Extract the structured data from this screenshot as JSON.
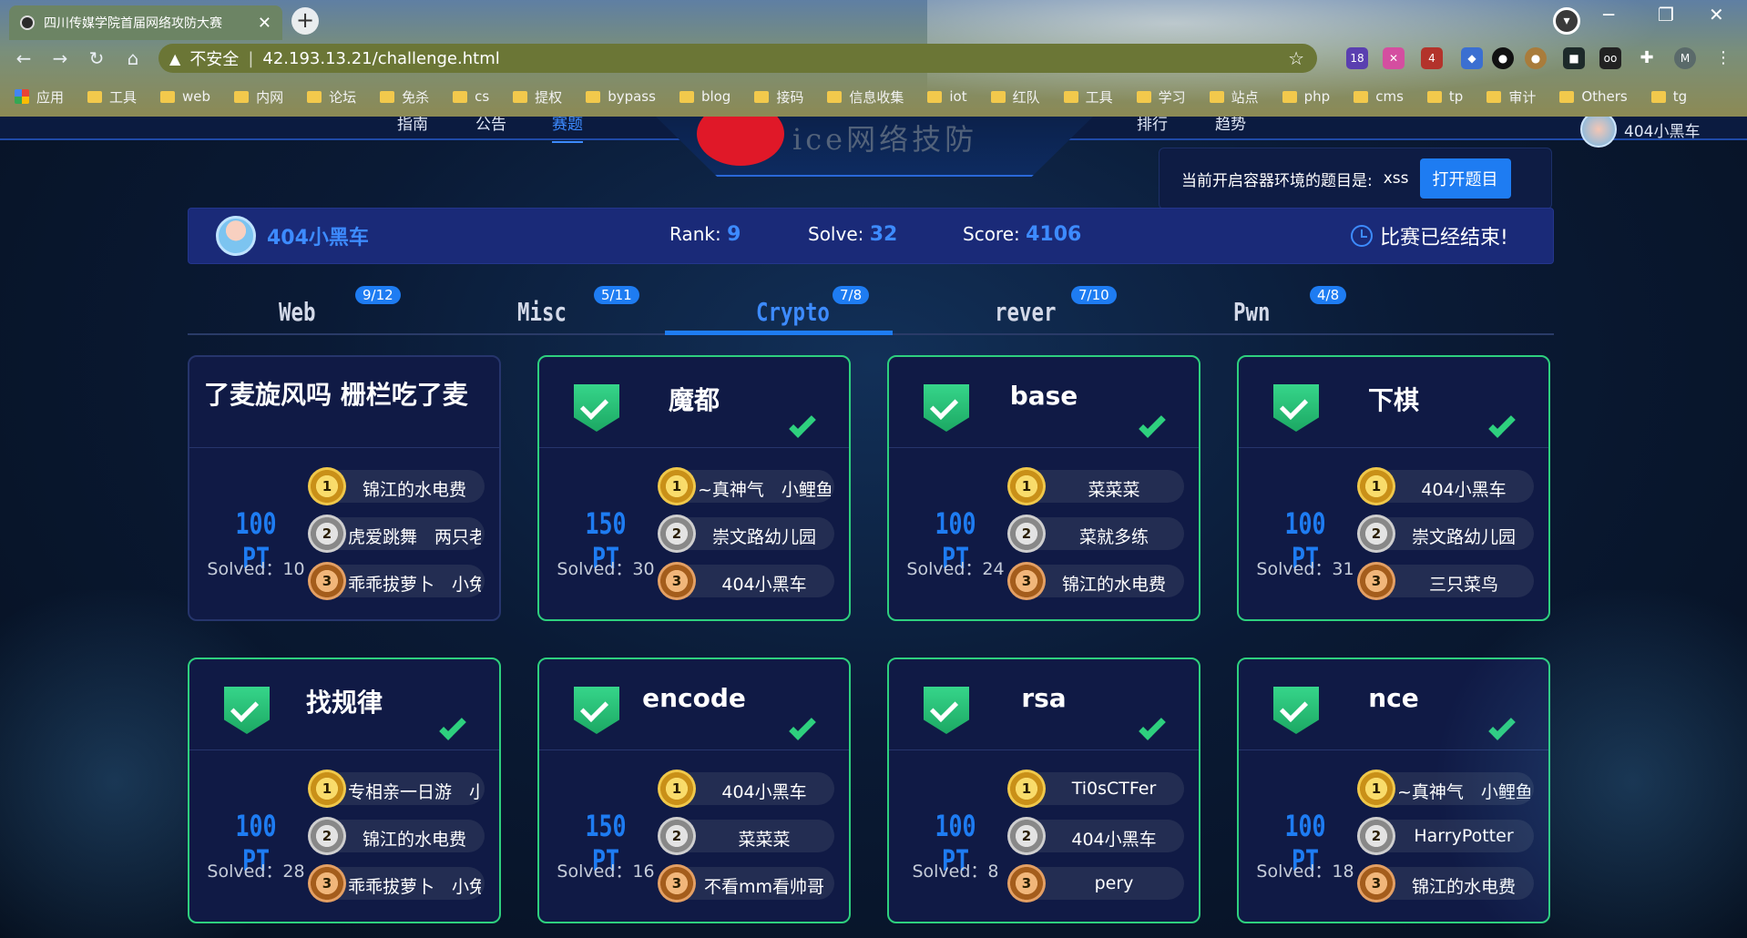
{
  "browser": {
    "tab_title": "四川传媒学院首届网络攻防大赛",
    "url_warning": "不安全",
    "url": "42.193.13.21/challenge.html",
    "profile_initial": "M",
    "ext_badge_1": "18",
    "ext_badge_2": "4",
    "bookmarks": [
      "应用",
      "工具",
      "web",
      "内网",
      "论坛",
      "免杀",
      "cs",
      "提权",
      "bypass",
      "blog",
      "接码",
      "信息收集",
      "iot",
      "红队",
      "工具",
      "学习",
      "站点",
      "php",
      "cms",
      "tp",
      "审计",
      "Others",
      "tg"
    ]
  },
  "site": {
    "nav_left": [
      "指南",
      "公告",
      "赛题"
    ],
    "nav_right": [
      "排行",
      "趋势"
    ],
    "logo_text": "ice网络技防",
    "user_top": "404小黑车",
    "container_label": "当前开启容器环境的题目是:",
    "container_value": "xss",
    "open_button": "打开题目"
  },
  "status": {
    "username": "404小黑车",
    "rank_label": "Rank:",
    "rank": "9",
    "solve_label": "Solve:",
    "solve": "32",
    "score_label": "Score:",
    "score": "4106",
    "ended_text": "比赛已经结束!"
  },
  "categories": [
    {
      "name": "Web",
      "count": "9/12"
    },
    {
      "name": "Misc",
      "count": "5/11"
    },
    {
      "name": "Crypto",
      "count": "7/8"
    },
    {
      "name": "rever",
      "count": "7/10"
    },
    {
      "name": "Pwn",
      "count": "4/8"
    }
  ],
  "cards": [
    {
      "title": "了麦旋风吗 栅栏吃了麦",
      "points": "100 PT",
      "solved": "Solved：10",
      "solvers": [
        "锦江的水电费",
        "虎爱跳舞　两只老",
        "乖乖拔萝卜　小兔"
      ]
    },
    {
      "title": "魔都",
      "points": "150 PT",
      "solved": "Solved：30",
      "solvers": [
        "~真神气　小鲤鱼",
        "崇文路幼儿园",
        "404小黑车"
      ]
    },
    {
      "title": "base",
      "points": "100 PT",
      "solved": "Solved：24",
      "solvers": [
        "菜菜菜",
        "菜就多练",
        "锦江的水电费"
      ]
    },
    {
      "title": "下棋",
      "points": "100 PT",
      "solved": "Solved：31",
      "solvers": [
        "404小黑车",
        "崇文路幼儿园",
        "三只菜鸟"
      ]
    },
    {
      "title": "找规律",
      "points": "100 PT",
      "solved": "Solved：28",
      "solvers": [
        "专相亲一日游　小",
        "锦江的水电费",
        "乖乖拔萝卜　小兔"
      ]
    },
    {
      "title": "encode",
      "points": "150 PT",
      "solved": "Solved：16",
      "solvers": [
        "404小黑车",
        "菜菜菜",
        "不看mm看帅哥"
      ]
    },
    {
      "title": "rsa",
      "points": "100 PT",
      "solved": "Solved：8",
      "solvers": [
        "Ti0sCTFer",
        "404小黑车",
        "pery"
      ]
    },
    {
      "title": "nce",
      "points": "100 PT",
      "solved": "Solved：18",
      "solvers": [
        "~真神气　小鲤鱼",
        "HarryPotter",
        "锦江的水电费"
      ]
    }
  ],
  "colors": {
    "accent": "#1e7cf2",
    "solved_border": "#2ed07e",
    "card_bg": "#101a45"
  }
}
